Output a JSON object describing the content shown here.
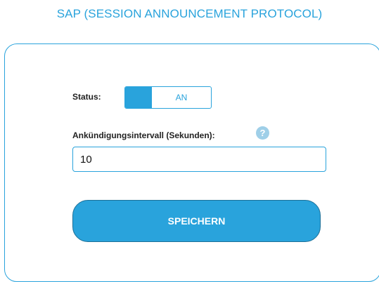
{
  "page": {
    "title": "SAP (SESSION ANNOUNCEMENT PROTOCOL)"
  },
  "form": {
    "status_label": "Status:",
    "status_value": "AN",
    "interval_label": "Ankündigungsintervall (Sekunden):",
    "interval_value": "10",
    "help_icon": "question-mark",
    "save_label": "SPEICHERN"
  },
  "colors": {
    "accent": "#29a3dc",
    "button_border": "#1c6f97",
    "help_icon": "#9fcfe8"
  }
}
